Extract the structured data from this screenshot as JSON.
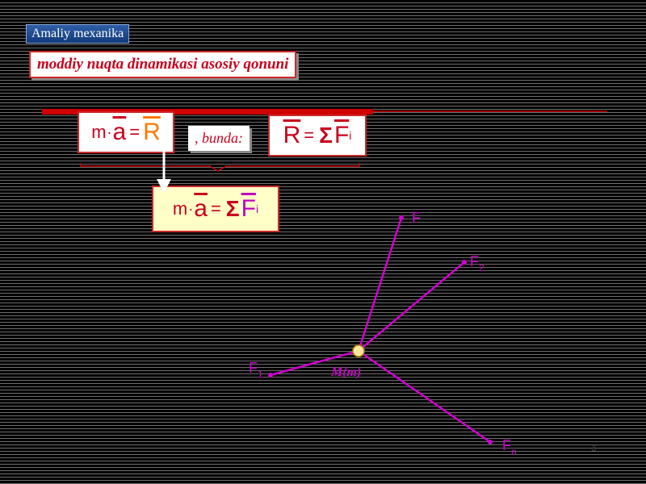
{
  "header": {
    "label": "Amaliy mexanika",
    "subtitle": "moddiy nuqta dinamikasi asosiy qonuni"
  },
  "formula1": {
    "m": "m",
    "dot": "·",
    "a": "a",
    "eq": "=",
    "R": "R"
  },
  "bunda": ", bunda:",
  "formula2": {
    "R": "R",
    "eq": "=",
    "sigma": "Σ",
    "F": "F",
    "i": "i"
  },
  "formula3": {
    "m": "m",
    "dot": "·",
    "a": "a",
    "eq": "=",
    "sigma": "Σ",
    "F": "F",
    "i": "i"
  },
  "diagram": {
    "point_label": "M(m)",
    "force_labels": [
      "F",
      "F",
      "F",
      "F"
    ],
    "force_subscripts": [
      "",
      "2",
      "1",
      "n"
    ],
    "point_color": "#ffe6a0",
    "force_color": "#d000d0"
  },
  "page_number": "3",
  "colors": {
    "accent_red": "#c8001c",
    "formula_highlight": "#ffffc8"
  }
}
